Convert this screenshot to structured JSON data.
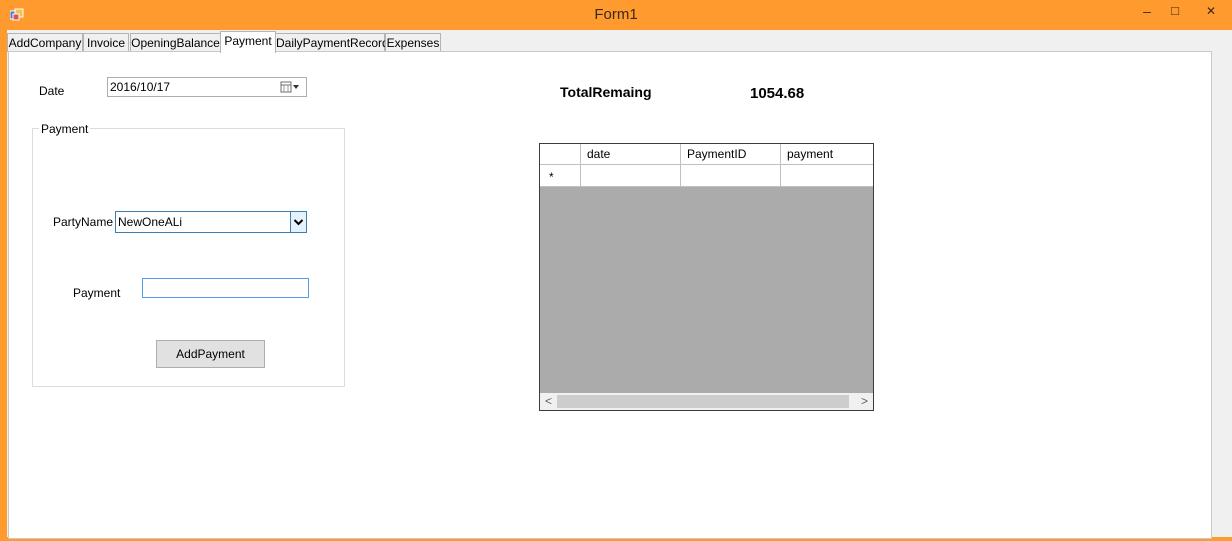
{
  "window": {
    "title": "Form1",
    "minimize": "–",
    "maximize": "□",
    "close": "✕"
  },
  "tabs": [
    {
      "label": "AddCompany"
    },
    {
      "label": "Invoice"
    },
    {
      "label": "OpeningBalance"
    },
    {
      "label": "Payment",
      "active": true
    },
    {
      "label": "DailyPaymentRecord"
    },
    {
      "label": "Expenses"
    }
  ],
  "form": {
    "date_label": "Date",
    "date_value": "2016/10/17",
    "group_title": "Payment",
    "party_label": "PartyName",
    "party_value": "NewOneALi",
    "payment_label": "Payment",
    "payment_value": "",
    "add_button": "AddPayment",
    "total_label": "TotalRemaing",
    "total_value": "1054.68"
  },
  "grid": {
    "columns": [
      "date",
      "PaymentID",
      "payment"
    ],
    "new_row_marker": "*"
  },
  "scroll": {
    "left": "<",
    "right": ">"
  },
  "colors": {
    "titlebar": "#fe9a2e",
    "grid_empty": "#ababab",
    "focus_border": "#3c7fb1"
  },
  "icons": {
    "app": "app-icon",
    "calendar": "calendar-icon",
    "dropdown": "chevron-down-icon"
  }
}
